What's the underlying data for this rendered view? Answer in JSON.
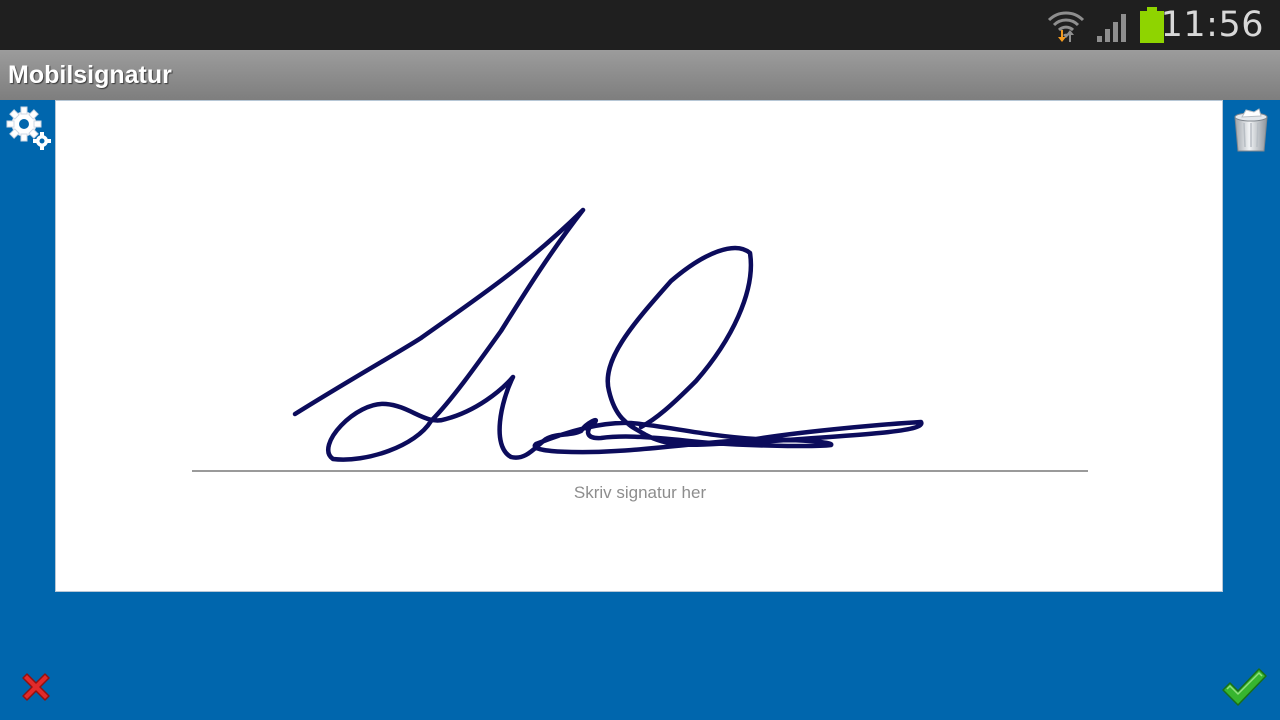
{
  "status_bar": {
    "time": "11:56"
  },
  "app": {
    "title": "Mobilsignatur"
  },
  "signature_pad": {
    "hint": "Skriv signatur her",
    "ink_color": "#0c0c5c"
  },
  "colors": {
    "background": "#0066ad",
    "status_bar": "#1f1f1f",
    "battery": "#8fd400"
  },
  "icons": {
    "settings": "gears-icon",
    "clear": "trash-can-icon",
    "cancel": "red-x-icon",
    "confirm": "green-checkmark-icon"
  }
}
